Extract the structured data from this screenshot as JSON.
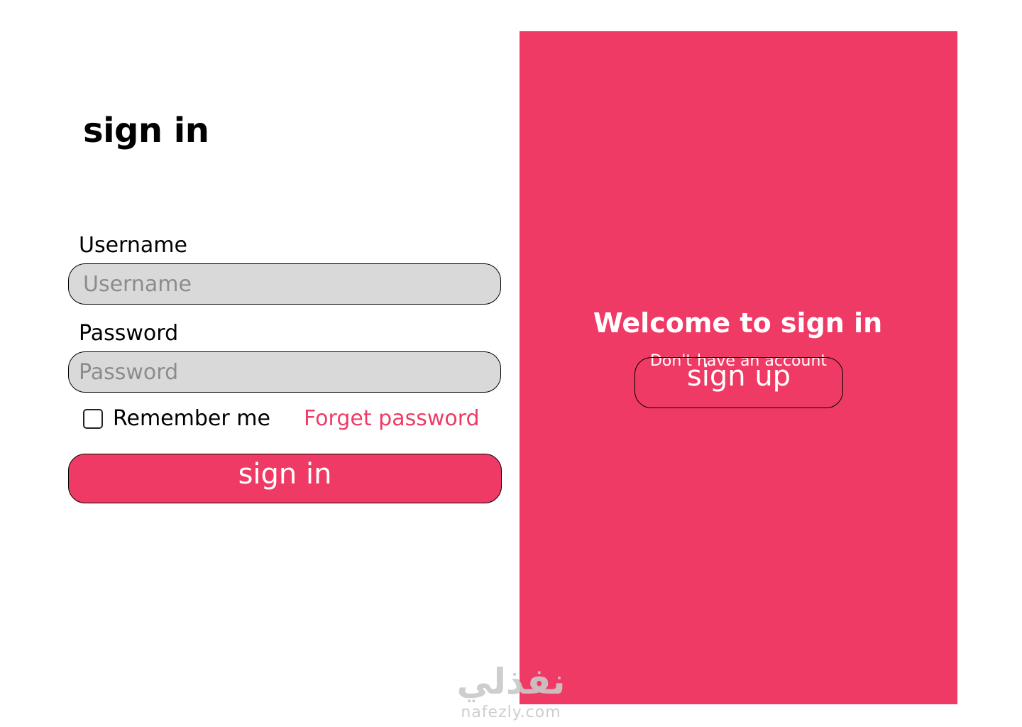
{
  "page": {
    "title": "sign in"
  },
  "form": {
    "username_label": "Username",
    "username_placeholder": "Username",
    "password_label": "Password",
    "password_placeholder": "Password",
    "remember_label": "Remember me",
    "remember_checked": false,
    "forget_link": "Forget password",
    "submit_label": "sign in"
  },
  "panel": {
    "welcome": "Welcome to sign in",
    "no_account": "Don't have an account",
    "signup_label": "sign up"
  },
  "watermark": {
    "arabic": "نفذلي",
    "latin": "nafezly.com"
  },
  "colors": {
    "accent": "#f03a66",
    "input_bg": "#d9d9d9",
    "placeholder": "#8c8c8c",
    "watermark": "#c9c9c9"
  }
}
